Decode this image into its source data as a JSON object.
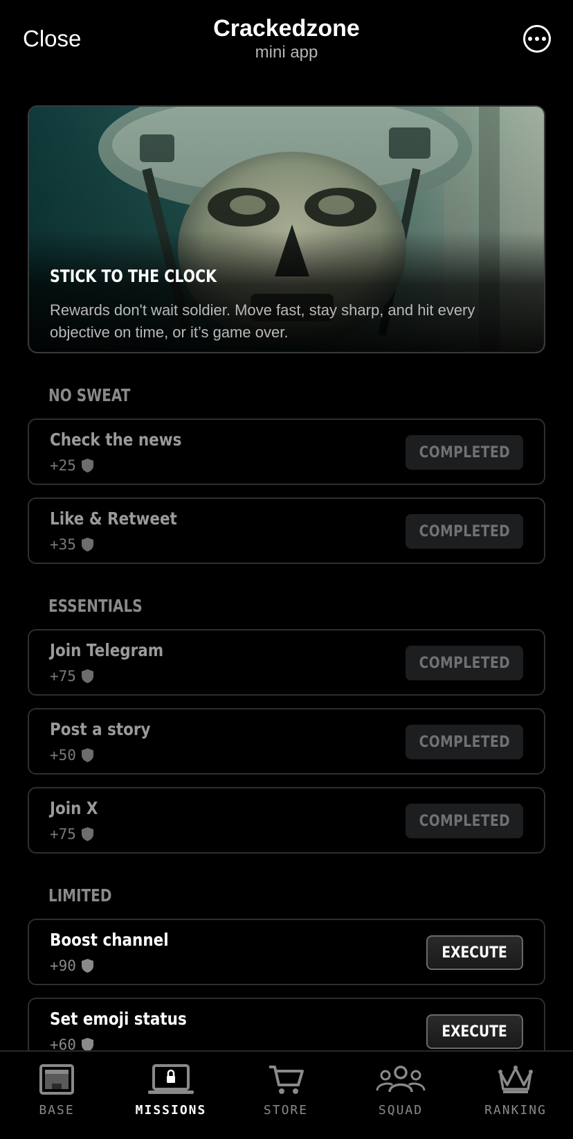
{
  "header": {
    "close_label": "Close",
    "title": "Crackedzone",
    "subtitle": "mini app",
    "more_icon": "more-options-icon"
  },
  "hero": {
    "title": "STICK TO THE CLOCK",
    "description": "Rewards don't wait soldier. Move fast, stay sharp, and hit every objective on time, or it’s game over."
  },
  "sections": [
    {
      "title": "NO SWEAT",
      "tasks": [
        {
          "name": "Check the news",
          "reward": "+25",
          "status": "COMPLETED"
        },
        {
          "name": "Like & Retweet",
          "reward": "+35",
          "status": "COMPLETED"
        }
      ]
    },
    {
      "title": "ESSENTIALS",
      "tasks": [
        {
          "name": "Join Telegram",
          "reward": "+75",
          "status": "COMPLETED"
        },
        {
          "name": "Post a story",
          "reward": "+50",
          "status": "COMPLETED"
        },
        {
          "name": "Join X",
          "reward": "+75",
          "status": "COMPLETED"
        }
      ]
    },
    {
      "title": "LIMITED",
      "tasks": [
        {
          "name": "Boost channel",
          "reward": "+90",
          "status": "EXECUTE"
        },
        {
          "name": "Set emoji status",
          "reward": "+60",
          "status": "EXECUTE"
        }
      ]
    }
  ],
  "nav": {
    "active": "MISSIONS",
    "items": [
      {
        "label": "BASE",
        "icon": "base-icon"
      },
      {
        "label": "MISSIONS",
        "icon": "laptop-lock-icon"
      },
      {
        "label": "STORE",
        "icon": "cart-icon"
      },
      {
        "label": "SQUAD",
        "icon": "group-icon"
      },
      {
        "label": "RANKING",
        "icon": "crown-icon"
      }
    ]
  },
  "colors": {
    "background": "#000000",
    "card_border": "#2e2e2e",
    "completed_bg": "#1c1e20",
    "muted_text": "#8a8a8a",
    "hero_tint": "#1f4a48"
  }
}
